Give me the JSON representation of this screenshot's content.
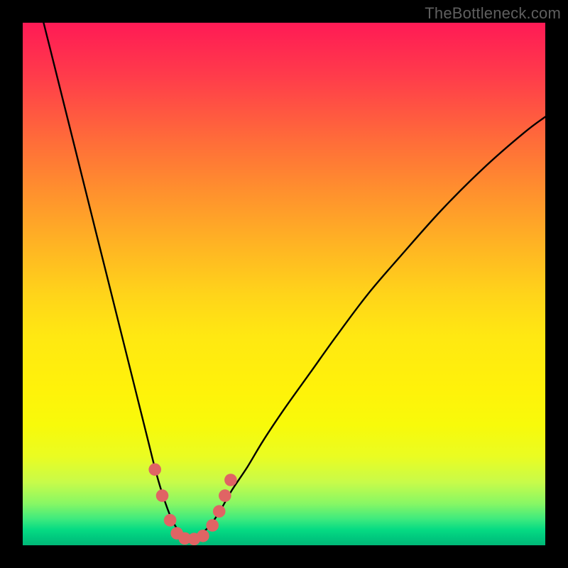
{
  "watermark": "TheBottleneck.com",
  "chart_data": {
    "type": "line",
    "title": "",
    "xlabel": "",
    "ylabel": "",
    "xlim": [
      0,
      100
    ],
    "ylim": [
      0,
      100
    ],
    "gradient_stops": [
      {
        "pos": 0,
        "color": "#ff1a55"
      },
      {
        "pos": 10,
        "color": "#ff3b4b"
      },
      {
        "pos": 22,
        "color": "#ff6a3a"
      },
      {
        "pos": 32,
        "color": "#ff8f2e"
      },
      {
        "pos": 42,
        "color": "#ffb224"
      },
      {
        "pos": 52,
        "color": "#ffd41a"
      },
      {
        "pos": 60,
        "color": "#ffe812"
      },
      {
        "pos": 70,
        "color": "#fff20a"
      },
      {
        "pos": 77,
        "color": "#f8fa0a"
      },
      {
        "pos": 83,
        "color": "#eafc22"
      },
      {
        "pos": 88,
        "color": "#c7fb4a"
      },
      {
        "pos": 92,
        "color": "#88f764"
      },
      {
        "pos": 95,
        "color": "#3dea7e"
      },
      {
        "pos": 97,
        "color": "#06db83"
      },
      {
        "pos": 98.5,
        "color": "#00c97e"
      },
      {
        "pos": 100,
        "color": "#00b877"
      }
    ],
    "series": [
      {
        "name": "bottleneck-curve",
        "color": "#000000",
        "x": [
          4,
          6,
          8,
          10,
          12,
          14,
          16,
          18,
          20,
          22,
          24,
          25.5,
          27,
          28.5,
          30,
          31,
          32,
          33,
          34,
          36,
          38,
          40,
          43,
          46,
          50,
          55,
          60,
          66,
          72,
          80,
          88,
          96,
          100
        ],
        "y": [
          100,
          92,
          84,
          76,
          68,
          60,
          52,
          44,
          36,
          28,
          20,
          14,
          9,
          5,
          2.5,
          1.5,
          1,
          1.3,
          2,
          4,
          7,
          10.5,
          15,
          20,
          26,
          33,
          40,
          48,
          55,
          64,
          72,
          79,
          82
        ]
      }
    ],
    "markers": [
      {
        "x": 25.3,
        "y": 14.5,
        "r": 1.2,
        "color": "#e06464"
      },
      {
        "x": 26.7,
        "y": 9.5,
        "r": 1.2,
        "color": "#e06464"
      },
      {
        "x": 28.2,
        "y": 4.8,
        "r": 1.2,
        "color": "#e06464"
      },
      {
        "x": 29.5,
        "y": 2.3,
        "r": 1.2,
        "color": "#e06464"
      },
      {
        "x": 31.0,
        "y": 1.3,
        "r": 1.2,
        "color": "#e06464"
      },
      {
        "x": 32.8,
        "y": 1.2,
        "r": 1.2,
        "color": "#e06464"
      },
      {
        "x": 34.5,
        "y": 1.8,
        "r": 1.2,
        "color": "#e06464"
      },
      {
        "x": 36.3,
        "y": 3.8,
        "r": 1.2,
        "color": "#e06464"
      },
      {
        "x": 37.6,
        "y": 6.5,
        "r": 1.2,
        "color": "#e06464"
      },
      {
        "x": 38.7,
        "y": 9.5,
        "r": 1.2,
        "color": "#e06464"
      },
      {
        "x": 39.8,
        "y": 12.5,
        "r": 1.2,
        "color": "#e06464"
      }
    ]
  }
}
